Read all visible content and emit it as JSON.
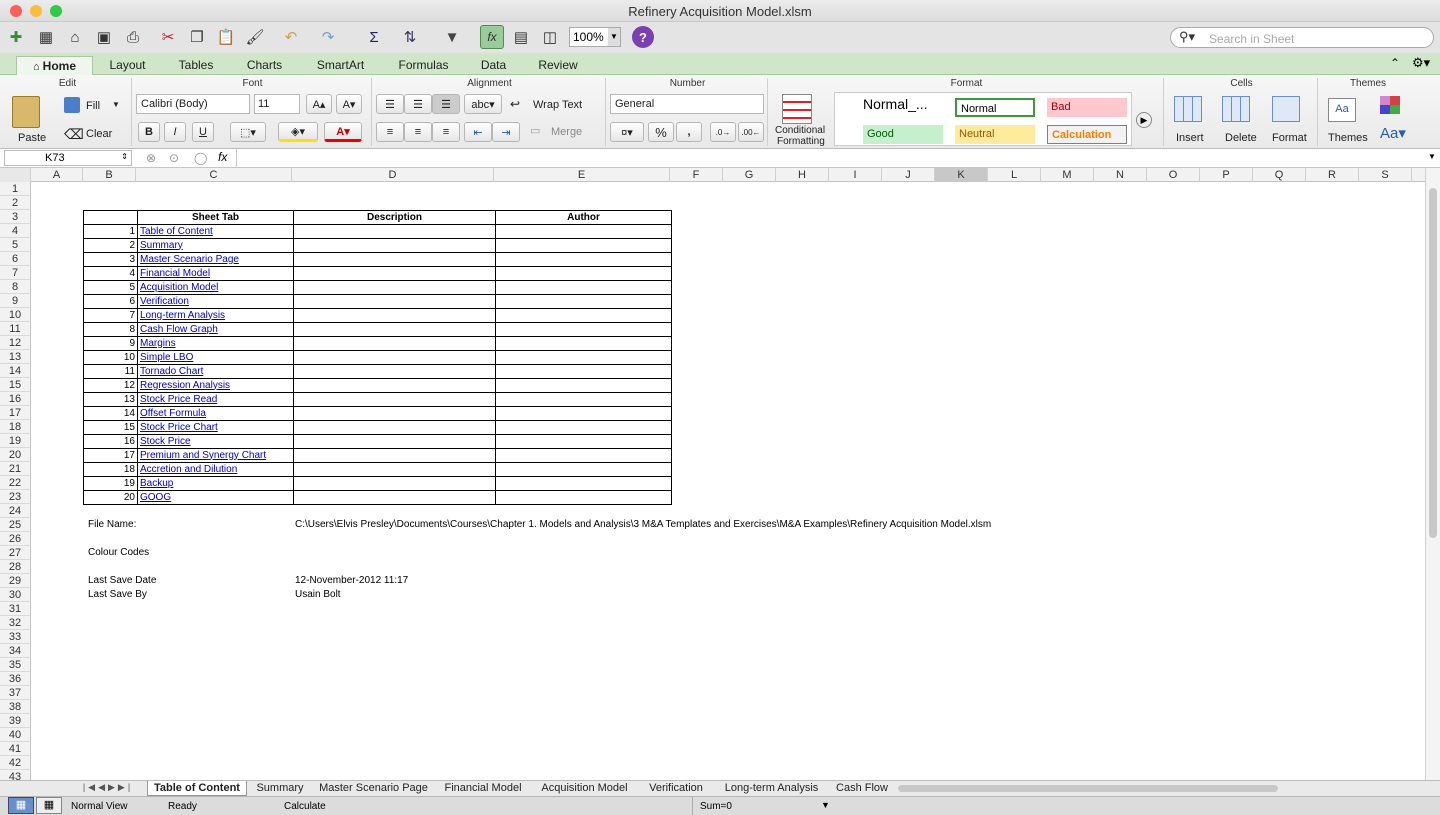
{
  "window": {
    "title": "Refinery Acquisition Model.xlsm"
  },
  "toolbar": {
    "zoom": "100%",
    "search_placeholder": "Search in Sheet"
  },
  "ribbon_tabs": [
    "Home",
    "Layout",
    "Tables",
    "Charts",
    "SmartArt",
    "Formulas",
    "Data",
    "Review"
  ],
  "ribbon": {
    "groups": {
      "edit": "Edit",
      "font": "Font",
      "alignment": "Alignment",
      "number": "Number",
      "format": "Format",
      "cells": "Cells",
      "themes": "Themes"
    },
    "edit": {
      "fill": "Fill",
      "clear": "Clear",
      "paste": "Paste"
    },
    "font": {
      "name": "Calibri (Body)",
      "size": "11"
    },
    "alignment": {
      "wrap_text": "Wrap Text",
      "merge": "Merge"
    },
    "number": {
      "format": "General"
    },
    "format": {
      "conditional": "Conditional",
      "formatting": "Formatting",
      "normal_big": "Normal_...",
      "normal": "Normal",
      "bad": "Bad",
      "good": "Good",
      "neutral": "Neutral",
      "calculation": "Calculation"
    },
    "cells": {
      "insert": "Insert",
      "delete": "Delete",
      "format": "Format"
    },
    "themes": {
      "themes": "Themes"
    }
  },
  "formula_bar": {
    "name_box": "K73",
    "fx": "fx",
    "content": ""
  },
  "columns": [
    "A",
    "B",
    "C",
    "D",
    "E",
    "F",
    "G",
    "H",
    "I",
    "J",
    "K",
    "L",
    "M",
    "N",
    "O",
    "P",
    "Q",
    "R",
    "S"
  ],
  "rows": [
    "1",
    "2",
    "3",
    "4",
    "5",
    "6",
    "7",
    "8",
    "9",
    "10",
    "11",
    "12",
    "13",
    "14",
    "15",
    "16",
    "17",
    "18",
    "19",
    "20",
    "21",
    "22",
    "23",
    "24",
    "25",
    "26",
    "27",
    "28",
    "29",
    "30",
    "31",
    "32",
    "33",
    "34",
    "35",
    "36",
    "37",
    "38",
    "39",
    "40",
    "41",
    "42",
    "43"
  ],
  "toc": {
    "headers": {
      "tab": "Sheet Tab",
      "description": "Description",
      "author": "Author"
    },
    "items": [
      {
        "n": "1",
        "name": "Table of Content"
      },
      {
        "n": "2",
        "name": "Summary"
      },
      {
        "n": "3",
        "name": "Master Scenario Page"
      },
      {
        "n": "4",
        "name": "Financial Model"
      },
      {
        "n": "5",
        "name": "Acquisition Model"
      },
      {
        "n": "6",
        "name": "Verification"
      },
      {
        "n": "7",
        "name": "Long-term Analysis"
      },
      {
        "n": "8",
        "name": "Cash Flow Graph"
      },
      {
        "n": "9",
        "name": "Margins"
      },
      {
        "n": "10",
        "name": "Simple LBO"
      },
      {
        "n": "11",
        "name": "Tornado Chart"
      },
      {
        "n": "12",
        "name": "Regression Analysis"
      },
      {
        "n": "13",
        "name": "Stock Price Read"
      },
      {
        "n": "14",
        "name": "Offset Formula "
      },
      {
        "n": "15",
        "name": "Stock Price Chart"
      },
      {
        "n": "16",
        "name": "Stock Price"
      },
      {
        "n": "17",
        "name": "Premium and Synergy Chart"
      },
      {
        "n": "18",
        "name": "Accretion  and Dilution"
      },
      {
        "n": "19",
        "name": "Backup"
      },
      {
        "n": "20",
        "name": "GOOG"
      }
    ]
  },
  "info": {
    "file_name_label": "File Name:",
    "file_name": "C:\\Users\\Elvis Presley\\Documents\\Courses\\Chapter 1. Models and Analysis\\3 M&A Templates and Exercises\\M&A Examples\\Refinery Acquisition Model.xlsm",
    "colour_codes": "Colour Codes",
    "last_save_date_label": "Last Save Date",
    "last_save_date": "12-November-2012 11:17",
    "last_save_by_label": "Last Save By",
    "last_save_by": "Usain Bolt"
  },
  "sheet_tabs": [
    "Table of Content",
    "Summary",
    "Master Scenario Page",
    "Financial Model",
    "Acquisition Model",
    "Verification",
    "Long-term Analysis",
    "Cash Flow"
  ],
  "status": {
    "view": "Normal View",
    "ready": "Ready",
    "calculate": "Calculate",
    "sum": "Sum=0"
  }
}
